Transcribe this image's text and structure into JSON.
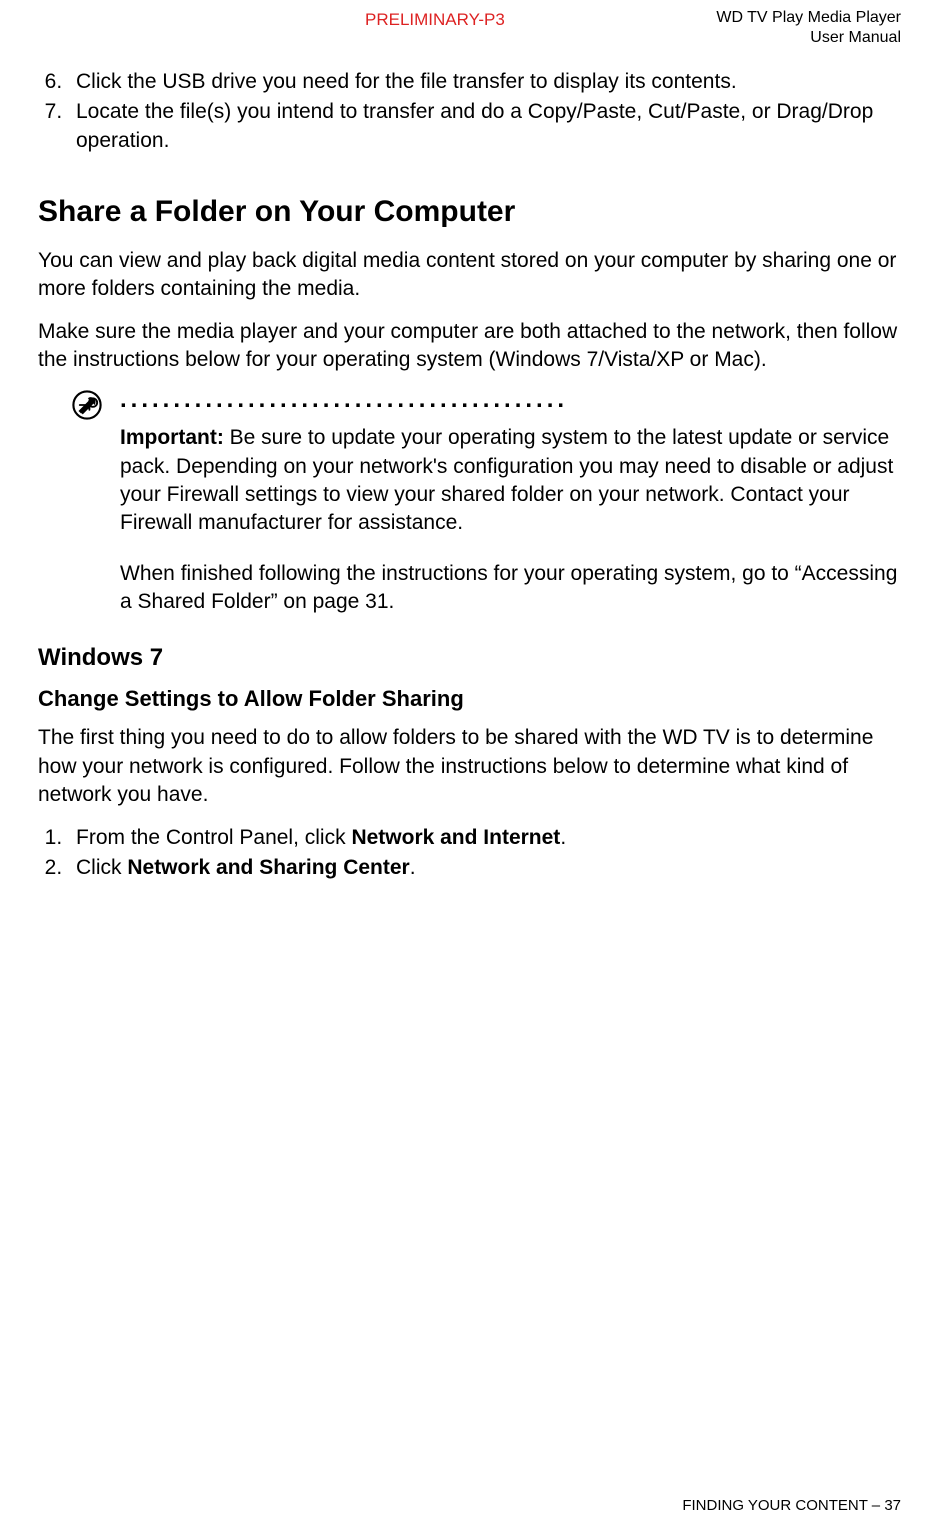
{
  "header": {
    "preliminary": "PRELIMINARY-P3",
    "product_line1": "WD TV Play Media Player",
    "product_line2": "User Manual"
  },
  "list_top": {
    "item6": "Click the USB drive you need for the file transfer to display its contents.",
    "item7": "Locate the file(s) you intend to transfer and do a Copy/Paste, Cut/Paste, or Drag/Drop operation."
  },
  "h1": "Share a Folder on Your Computer",
  "p1": "You can view and play back digital media content stored on your computer by sharing one or more folders containing the media.",
  "p2": "Make sure the media player and your computer are both attached to the network, then follow the instructions below for your operating system (Windows 7/Vista/XP or Mac).",
  "note": {
    "label": "Important:",
    "text": " Be sure to update your operating system to the latest update or service pack. Depending on your network's configuration you may need to disable or adjust your Firewall settings to view your shared folder on your network. Contact your Firewall manufacturer for assistance.",
    "text2": "When finished following the instructions for your operating system, go to “Accessing a Shared Folder” on page 31."
  },
  "h2": "Windows 7",
  "h3": "Change Settings to Allow Folder Sharing",
  "p3": "The first thing you need to do to allow folders to be shared with the WD TV is to determine how your network is configured. Follow the instructions below to determine what kind of network you have.",
  "steps": {
    "s1_pre": "From the Control Panel, click ",
    "s1_bold": "Network and Internet",
    "s1_post": ".",
    "s2_pre": "Click ",
    "s2_bold": "Network and Sharing Center",
    "s2_post": "."
  },
  "footer": {
    "section": "FINDING YOUR CONTENT",
    "sep": " – ",
    "page": "37"
  }
}
